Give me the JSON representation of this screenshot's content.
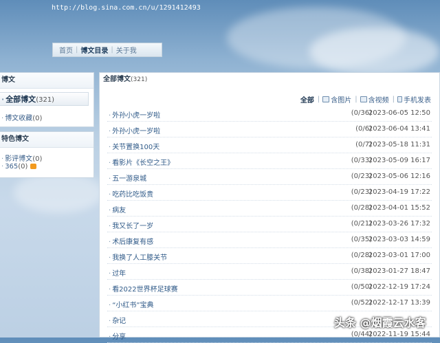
{
  "url": "http://blog.sina.com.cn/u/1291412493",
  "topnav": [
    {
      "label": "首页",
      "active": false
    },
    {
      "label": "博文目录",
      "active": true
    },
    {
      "label": "关于我",
      "active": false
    }
  ],
  "left": {
    "title": "博文",
    "all": {
      "label": "全部博文",
      "count": "(321)"
    },
    "favorites": {
      "label": "博文收藏",
      "count": "(0)"
    },
    "special_title": "特色博文",
    "special": [
      {
        "label": "影评博文",
        "count": "(0)"
      },
      {
        "label": "365",
        "count": "(0)"
      }
    ]
  },
  "main": {
    "title": "全部博文",
    "count": "(321)",
    "filters": {
      "all": "全部",
      "pics": "含图片",
      "video": "含视频",
      "mobile": "手机发表"
    },
    "rows": [
      {
        "title": "外孙小虎一岁啦",
        "count": "(0/36)",
        "date": "2023-06-05 12:50"
      },
      {
        "title": "外孙小虎一岁啦",
        "count": "(0/6)",
        "date": "2023-06-04 13:41"
      },
      {
        "title": "关节置换100天",
        "count": "(0/7)",
        "date": "2023-05-18 11:31"
      },
      {
        "title": "看影片《长空之王》",
        "count": "(0/33)",
        "date": "2023-05-09 16:17"
      },
      {
        "title": "五一游泉城",
        "count": "(0/23)",
        "date": "2023-05-06 12:16"
      },
      {
        "title": "吃药比吃饭贵",
        "count": "(0/23)",
        "date": "2023-04-19 17:22"
      },
      {
        "title": "病友",
        "count": "(0/28)",
        "date": "2023-04-01 15:52"
      },
      {
        "title": "我又长了一岁",
        "count": "(0/21)",
        "date": "2023-03-26 17:32"
      },
      {
        "title": "术后康复有感",
        "count": "(0/35)",
        "date": "2023-03-03 14:59"
      },
      {
        "title": "我换了人工膝关节",
        "count": "(0/28)",
        "date": "2023-03-01 17:00"
      },
      {
        "title": "过年",
        "count": "(0/38)",
        "date": "2023-01-27 18:47"
      },
      {
        "title": "看2022世界杯足球赛",
        "count": "(0/50)",
        "date": "2022-12-19 17:24"
      },
      {
        "title": "“小红书”宝典",
        "count": "(0/52)",
        "date": "2022-12-17 13:39"
      },
      {
        "title": "杂记",
        "count": "",
        "date": ""
      },
      {
        "title": "分享",
        "count": "(0/44)",
        "date": "2022-11-19 15:44"
      }
    ]
  },
  "watermark": "头条 @烟霞云水客"
}
